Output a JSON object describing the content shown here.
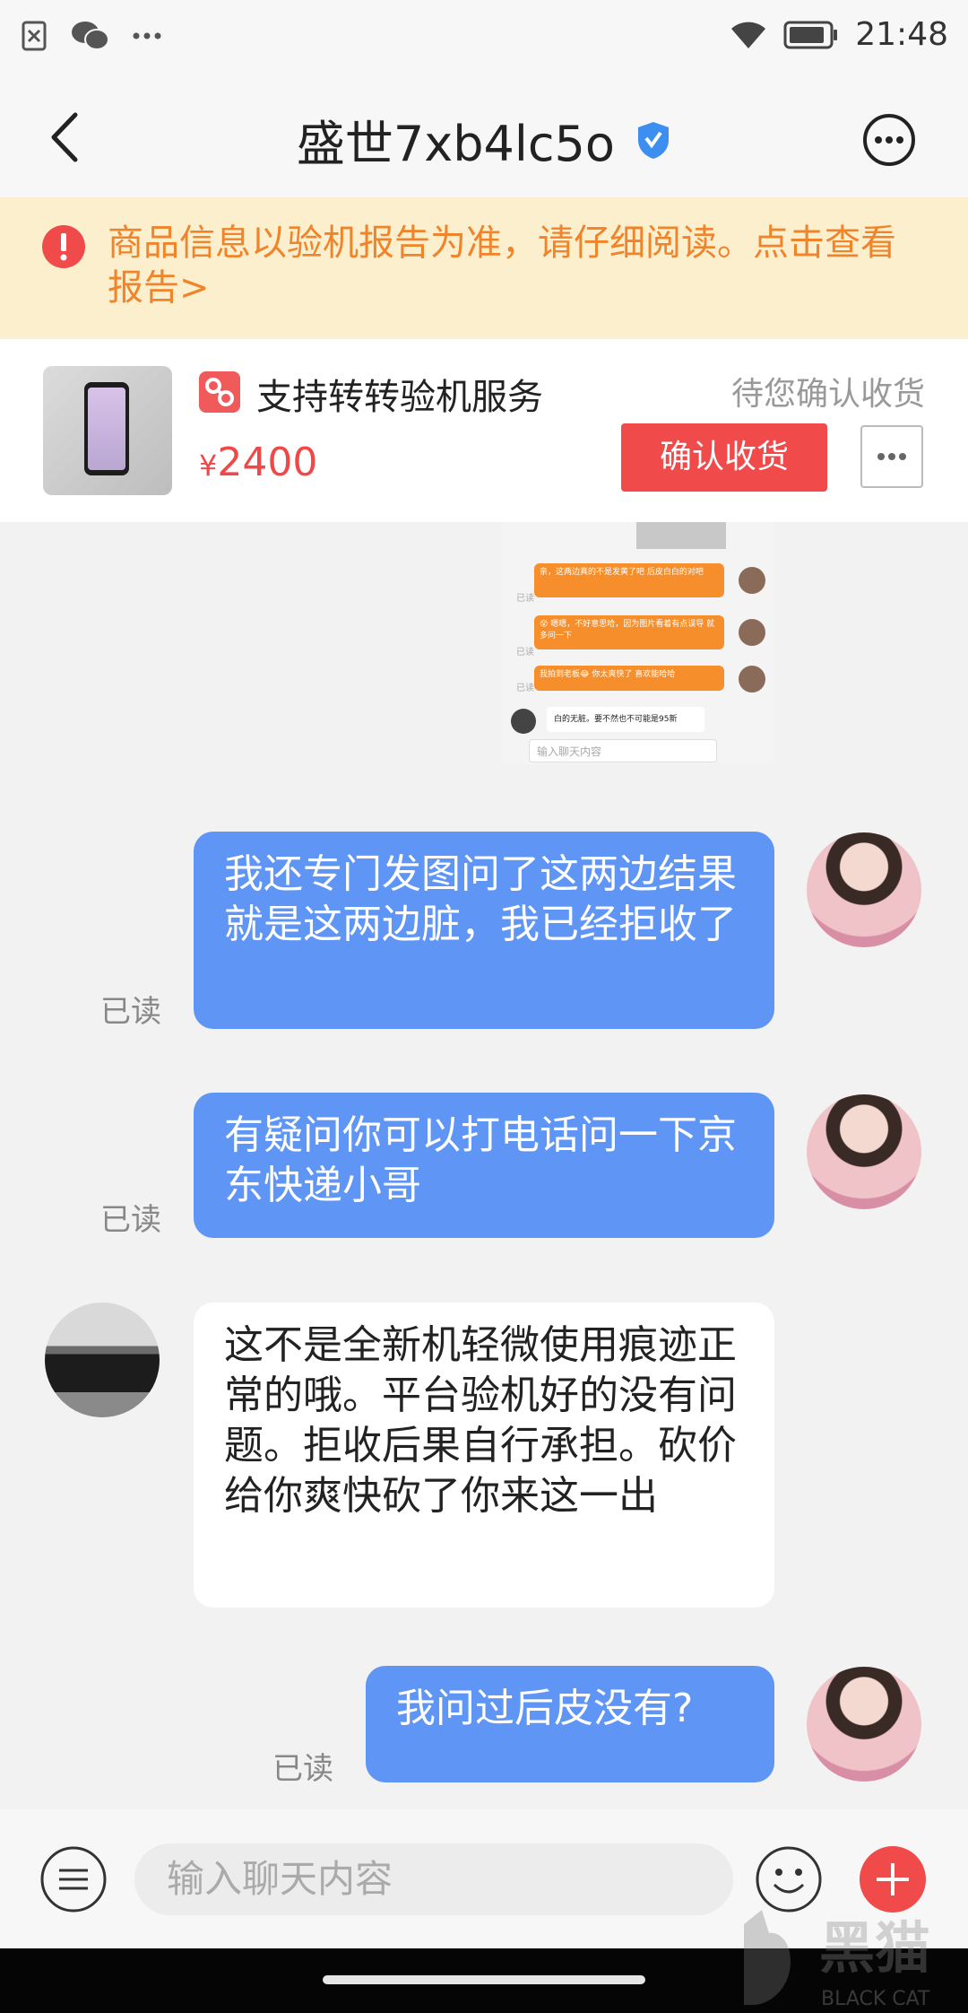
{
  "status_bar": {
    "time": "21:48"
  },
  "header": {
    "title": "盛世7xb4lc5o"
  },
  "notice": {
    "text": "商品信息以验机报告为准，请仔细阅读。点击查看报告>"
  },
  "product": {
    "service_label": "支持转转验机服务",
    "status": "待您确认收货",
    "price_symbol": "¥",
    "price": "2400",
    "confirm_label": "确认收货"
  },
  "embedded_screenshot": {
    "msg1": "亲，这两边真的不是发黄了吧 后皮白白的对吧",
    "msg2": "😵 嗯嗯，不好意思哈，因为图片看着有点误导 就多问一下",
    "msg3": "我拍到老板😂 你太爽快了 喜欢能哈哈",
    "reply": "白的无脏。要不然也不可能是95新",
    "read": "已读",
    "input_placeholder": "输入聊天内容"
  },
  "messages": [
    {
      "side": "me",
      "text": "我还专门发图问了这两边结果就是这两边脏，我已经拒收了",
      "read": "已读"
    },
    {
      "side": "me",
      "text": "有疑问你可以打电话问一下京东快递小哥",
      "read": "已读"
    },
    {
      "side": "them",
      "text": "这不是全新机轻微使用痕迹正常的哦。平台验机好的没有问题。拒收后果自行承担。砍价给你爽快砍了你来这一出"
    },
    {
      "side": "me",
      "text": "我问过后皮没有?",
      "read": "已读"
    }
  ],
  "input": {
    "placeholder": "输入聊天内容"
  },
  "watermark": {
    "cn": "黑猫",
    "en": "BLACK CAT"
  },
  "colors": {
    "accent": "#f04a4a",
    "bubble_me": "#5f95f5",
    "notice_bg": "#fbefcd",
    "notice_text": "#f0842a"
  },
  "icons": [
    "close-notification-icon",
    "wechat-icon",
    "more-dots-icon",
    "wifi-icon",
    "battery-icon",
    "back-icon",
    "verified-shield-icon",
    "more-options-icon",
    "warning-icon",
    "zhuanzhuan-service-icon",
    "menu-icon",
    "emoji-icon",
    "plus-icon"
  ]
}
